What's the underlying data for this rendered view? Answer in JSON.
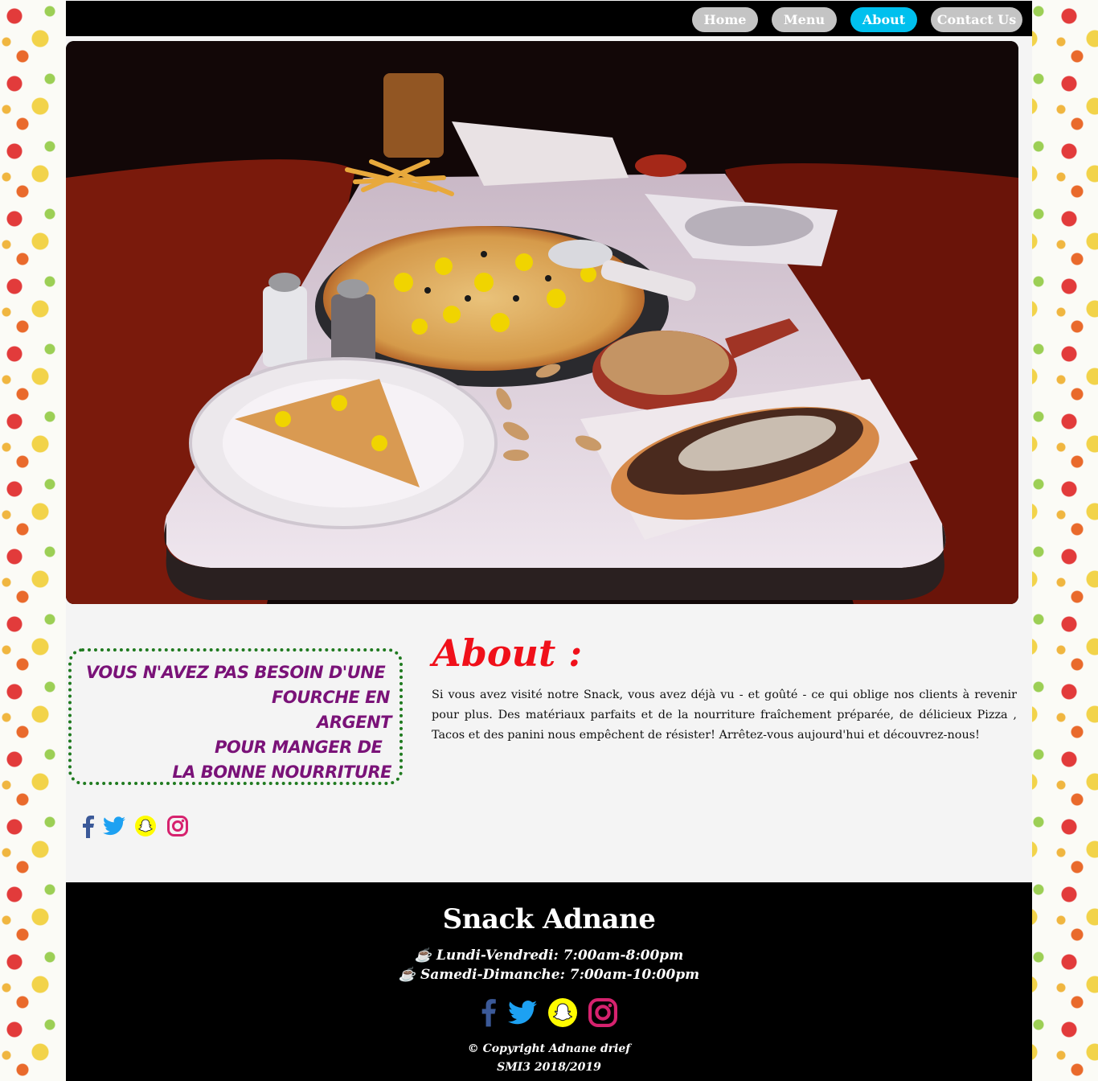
{
  "nav": {
    "items": [
      {
        "label": "Home",
        "active": false
      },
      {
        "label": "Menu",
        "active": false
      },
      {
        "label": "About",
        "active": true
      },
      {
        "label": "Contact Us",
        "active": false
      }
    ]
  },
  "quote": {
    "lines": [
      "VOUS N'AVEZ PAS BESOIN D'UNE",
      "FOURCHE EN",
      "ARGENT",
      "POUR MANGER DE",
      "LA BONNE NOURRITURE"
    ]
  },
  "about": {
    "title": "About :",
    "text": "Si vous avez visité notre Snack, vous avez déjà vu - et goûté - ce qui oblige nos clients à revenir pour plus. Des matériaux parfaits et de la nourriture fraîchement préparée, de délicieux Pizza , Tacos et des panini nous empêchent de résister! Arrêtez-vous aujourd'hui et découvrez-nous!"
  },
  "social": {
    "icons": [
      "facebook-icon",
      "twitter-icon",
      "snapchat-icon",
      "instagram-icon"
    ],
    "colors": {
      "facebook": "#3b5998",
      "twitter": "#1da1f2",
      "snapchat": "#fffc00",
      "instagram": "#d6226e"
    }
  },
  "footer": {
    "brand": "Snack Adnane",
    "hours": [
      "☕ Lundi-Vendredi: 7:00am-8:00pm",
      "☕ Samedi-Dimanche: 7:00am-10:00pm"
    ],
    "copyright": [
      "© Copyright Adnane drief",
      "SMI3 2018/2019"
    ]
  },
  "colors": {
    "nav_active": "#00c0ee",
    "nav_inactive": "#c4c4c4",
    "about_title": "#f0101a",
    "quote_text": "#7a1278",
    "quote_border": "#1f7a1f"
  }
}
